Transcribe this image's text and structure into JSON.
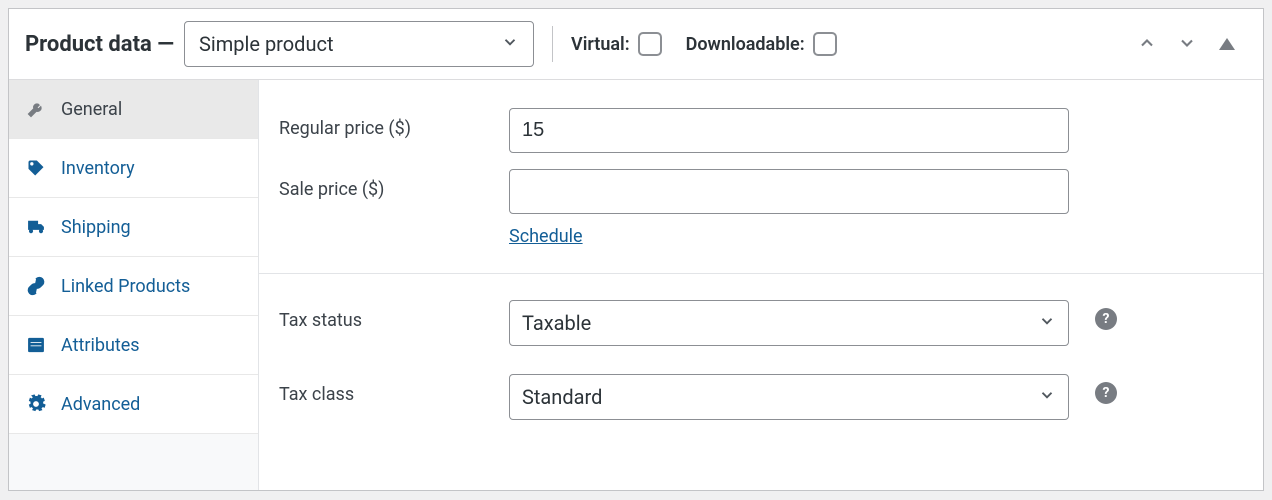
{
  "header": {
    "title_prefix": "Product data",
    "title_dash": " — ",
    "product_type": "Simple product",
    "virtual_label": "Virtual:",
    "downloadable_label": "Downloadable:"
  },
  "sidebar": {
    "items": [
      {
        "label": "General"
      },
      {
        "label": "Inventory"
      },
      {
        "label": "Shipping"
      },
      {
        "label": "Linked Products"
      },
      {
        "label": "Attributes"
      },
      {
        "label": "Advanced"
      }
    ]
  },
  "general": {
    "regular_price_label": "Regular price ($)",
    "regular_price_value": "15",
    "sale_price_label": "Sale price ($)",
    "sale_price_value": "",
    "schedule_link": "Schedule",
    "tax_status_label": "Tax status",
    "tax_status_value": "Taxable",
    "tax_class_label": "Tax class",
    "tax_class_value": "Standard",
    "help_char": "?"
  }
}
